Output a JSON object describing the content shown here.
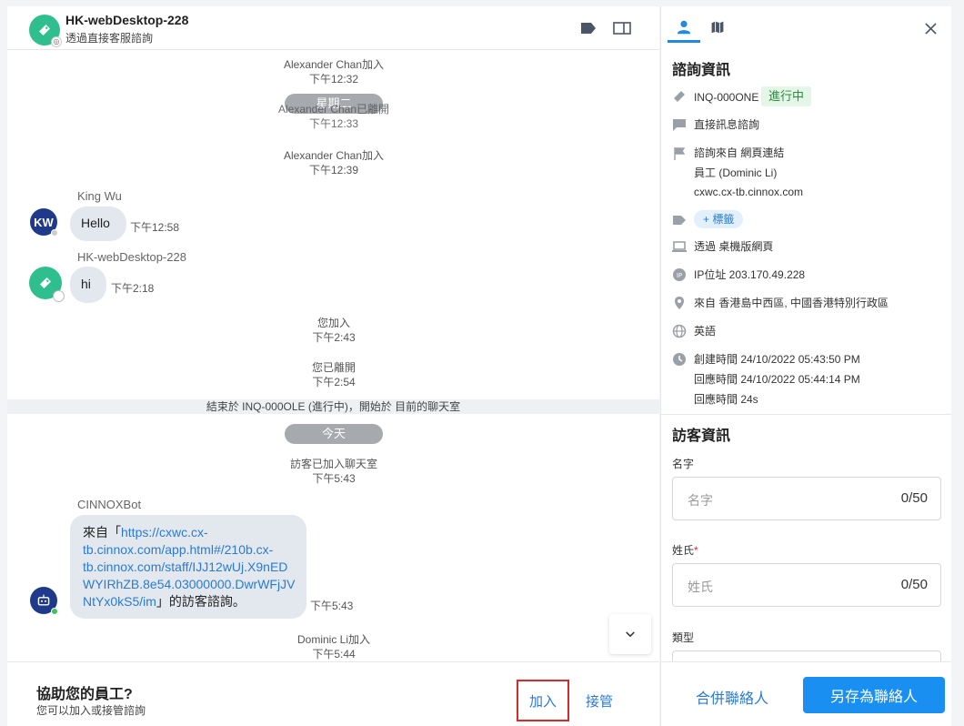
{
  "header": {
    "title": "HK-webDesktop-228",
    "subtitle": "透過直接客服諮詢"
  },
  "timeline": {
    "sys1_text": "Alexander Chan加入",
    "sys1_time": "下午12:32",
    "pill_tuesday": "星期二",
    "sys2_text": "Alexander Chan已離開",
    "sys2_time": "下午12:33",
    "sys3_text": "Alexander Chan加入",
    "sys3_time": "下午12:39",
    "msg1_user": "King Wu",
    "msg1_avatar": "KW",
    "msg1_text": "Hello",
    "msg1_time": "下午12:58",
    "msg2_user": "HK-webDesktop-228",
    "msg2_text": "hi",
    "msg2_time": "下午2:18",
    "sys4_text": "您加入",
    "sys4_time": "下午2:43",
    "sys5_text": "您已離開",
    "sys5_time": "下午2:54",
    "divider": "結束於 INQ-000OLE (進行中)，開始於 目前的聊天室",
    "pill_today": "今天",
    "sys6_text": "訪客已加入聊天室",
    "sys6_time": "下午5:43",
    "bot_user": "CINNOXBot",
    "bot_prefix": "來自「",
    "bot_link_l1": "https://cxwc.cx-",
    "bot_link_l2": "tb.cinnox.com/app.html#/210b.cx-",
    "bot_link_l3": "tb.cinnox.com/staff/IJJ12wUj.X9nED",
    "bot_link_l4": "WYIRhZB.8e54.03000000.DwrWFjJV",
    "bot_link_l5": "NtYx0kS5/im",
    "bot_suffix": "」的訪客諮詢。",
    "bot_time": "下午5:43",
    "sys7_text": "Dominic Li加入",
    "sys7_time": "下午5:44"
  },
  "footer": {
    "title": "協助您的員工?",
    "subtitle": "您可以加入或接管諮詢",
    "join_label": "加入",
    "takeover_label": "接管"
  },
  "inquiry": {
    "section_title": "諮詢資訊",
    "id": "INQ-000ONE",
    "status": "進行中",
    "type": "直接訊息諮詢",
    "source_line": "諮詢來自 網頁連結",
    "staff_line": "員工 (Dominic Li)",
    "url": "cxwc.cx-tb.cinnox.com",
    "tag_label": "+ 標籤",
    "via": "透過 桌機版網頁",
    "ip": "IP位址 203.170.49.228",
    "location": "來自 香港島中西區, 中國香港特別行政區",
    "language": "英語",
    "created": "創建時間 24/10/2022 05:43:50 PM",
    "responded": "回應時間 24/10/2022 05:44:14 PM",
    "response_time": "回應時間 24s"
  },
  "visitor": {
    "section_title": "訪客資訊",
    "name_label": "名字",
    "name_placeholder": "名字",
    "name_count": "0/50",
    "surname_label": "姓氏",
    "surname_required": "*",
    "surname_placeholder": "姓氏",
    "surname_count": "0/50",
    "type_label": "類型"
  },
  "actions": {
    "merge_label": "合併聯絡人",
    "save_label": "另存為聯絡人"
  },
  "colors": {
    "accent": "#1a8ff2",
    "link": "#2b7bd0",
    "status_green": "#2e8a3e",
    "highlight_red": "#d62b2b"
  }
}
